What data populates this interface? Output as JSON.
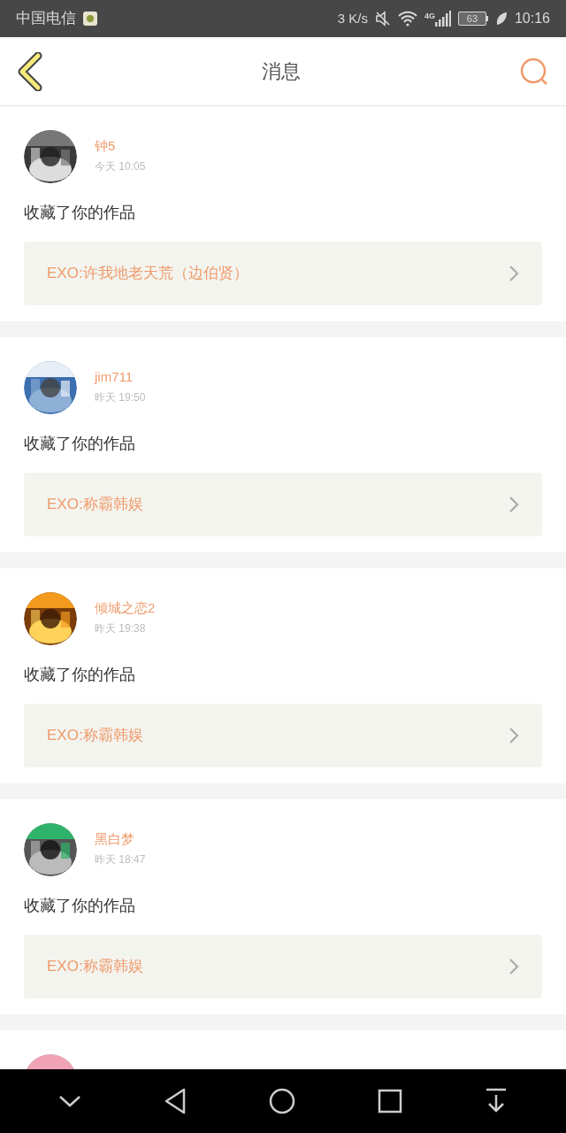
{
  "status_bar": {
    "carrier": "中国电信",
    "speed": "3 K/s",
    "network": "4G",
    "battery": "63",
    "time": "10:16"
  },
  "header": {
    "title": "消息"
  },
  "messages": [
    {
      "kind": "full",
      "name": "钟5",
      "time": "今天 10:05",
      "action": "收藏了你的作品",
      "work": "EXO:许我地老天荒（边伯贤）"
    },
    {
      "kind": "full",
      "name": "jim711",
      "time": "昨天 19:50",
      "action": "收藏了你的作品",
      "work": "EXO:称霸韩娱"
    },
    {
      "kind": "full",
      "name": "倾城之恋2",
      "time": "昨天 19:38",
      "action": "收藏了你的作品",
      "work": "EXO:称霸韩娱"
    },
    {
      "kind": "full",
      "name": "黑白梦",
      "time": "昨天 18:47",
      "action": "收藏了你的作品",
      "work": "EXO:称霸韩娱"
    },
    {
      "kind": "partial"
    }
  ]
}
